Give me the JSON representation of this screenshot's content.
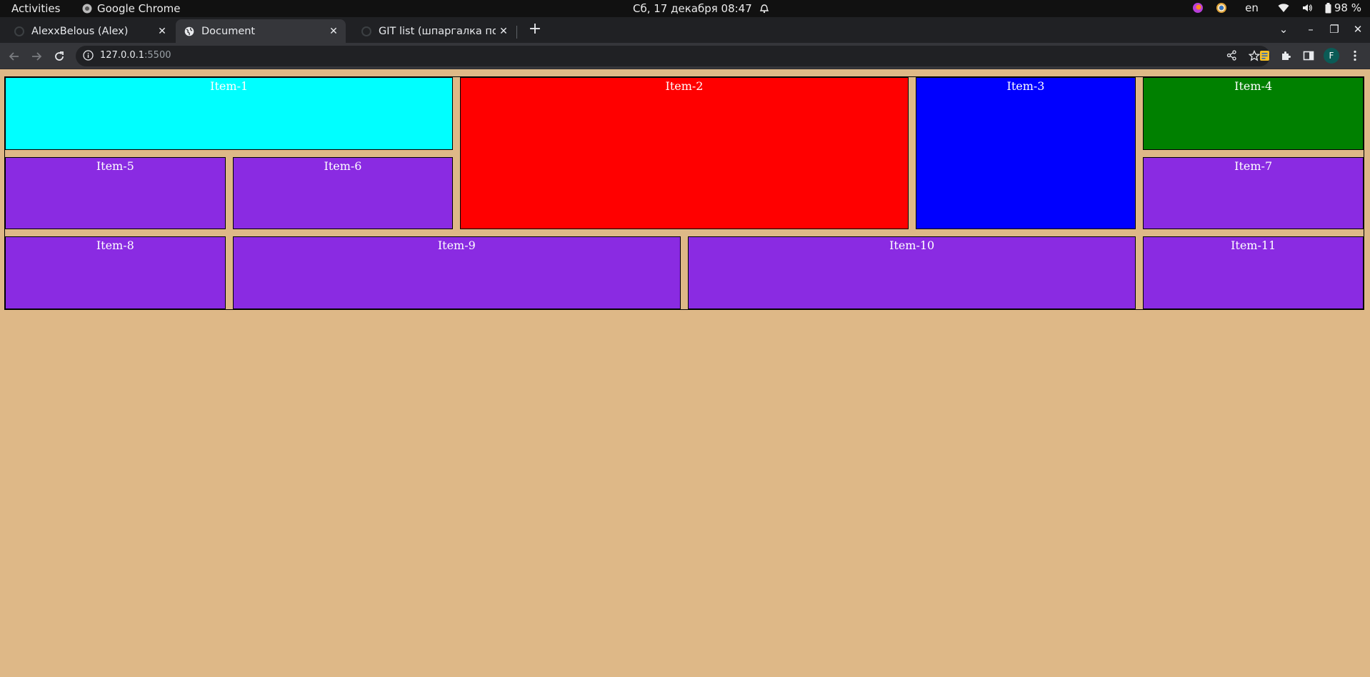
{
  "system_bar": {
    "activities": "Activities",
    "app_name": "Google Chrome",
    "datetime": "Сб, 17 декабря  08:47",
    "language": "en",
    "battery": "98 %"
  },
  "tabs": [
    {
      "title": "AlexxBelous (Alex)",
      "active": false
    },
    {
      "title": "Document",
      "active": true
    },
    {
      "title": "GIT list (шпаргалка по git",
      "active": false
    }
  ],
  "address_bar": {
    "host": "127.0.0.1",
    "port": ":5500"
  },
  "profile_initial": "F",
  "grid_items": [
    {
      "label": "Item-1",
      "color": "#00ffff"
    },
    {
      "label": "Item-2",
      "color": "#ff0000"
    },
    {
      "label": "Item-3",
      "color": "#0000ff"
    },
    {
      "label": "Item-4",
      "color": "#008000"
    },
    {
      "label": "Item-5",
      "color": "#8a2be2"
    },
    {
      "label": "Item-6",
      "color": "#8a2be2"
    },
    {
      "label": "Item-7",
      "color": "#8a2be2"
    },
    {
      "label": "Item-8",
      "color": "#8a2be2"
    },
    {
      "label": "Item-9",
      "color": "#8a2be2"
    },
    {
      "label": "Item-10",
      "color": "#8a2be2"
    },
    {
      "label": "Item-11",
      "color": "#8a2be2"
    }
  ],
  "colors": {
    "page_background": "#deb887"
  }
}
